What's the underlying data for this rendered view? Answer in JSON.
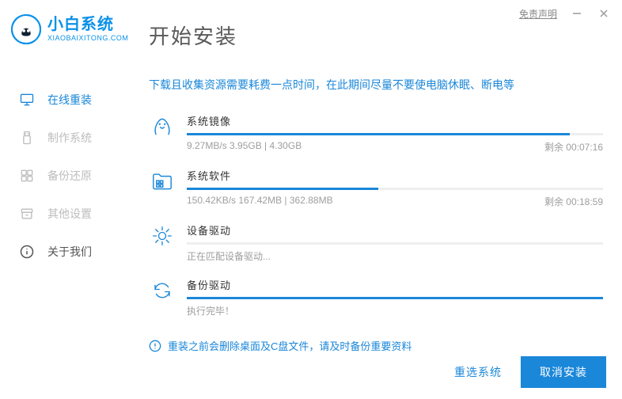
{
  "titlebar": {
    "disclaimer": "免责声明"
  },
  "logo": {
    "ch": "小白系统",
    "en": "XIAOBAIXITONG.COM"
  },
  "sidebar": {
    "items": [
      {
        "id": "online-reinstall",
        "label": "在线重装"
      },
      {
        "id": "make-system",
        "label": "制作系统"
      },
      {
        "id": "backup-restore",
        "label": "备份还原"
      },
      {
        "id": "other-settings",
        "label": "其他设置"
      },
      {
        "id": "about-us",
        "label": "关于我们"
      }
    ],
    "active": 0
  },
  "main": {
    "title": "开始安装",
    "tip": "下载且收集资源需要耗费一点时间，在此期间尽量不要使电脑休眠、断电等",
    "tasks": [
      {
        "id": "system-image",
        "title": "系统镜像",
        "detail": "9.27MB/s 3.95GB | 4.30GB",
        "right": "剩余 00:07:16",
        "percent": 92
      },
      {
        "id": "system-software",
        "title": "系统软件",
        "detail": "150.42KB/s 167.42MB | 362.88MB",
        "right": "剩余 00:18:59",
        "percent": 46
      },
      {
        "id": "device-driver",
        "title": "设备驱动",
        "detail": "正在匹配设备驱动...",
        "right": "",
        "percent": 0
      },
      {
        "id": "backup-driver",
        "title": "备份驱动",
        "detail": "执行完毕！",
        "right": "",
        "percent": 100
      }
    ],
    "warning": "重装之前会删除桌面及C盘文件，请及时备份重要资料"
  },
  "footer": {
    "reselect": "重选系统",
    "cancel": "取消安装"
  }
}
